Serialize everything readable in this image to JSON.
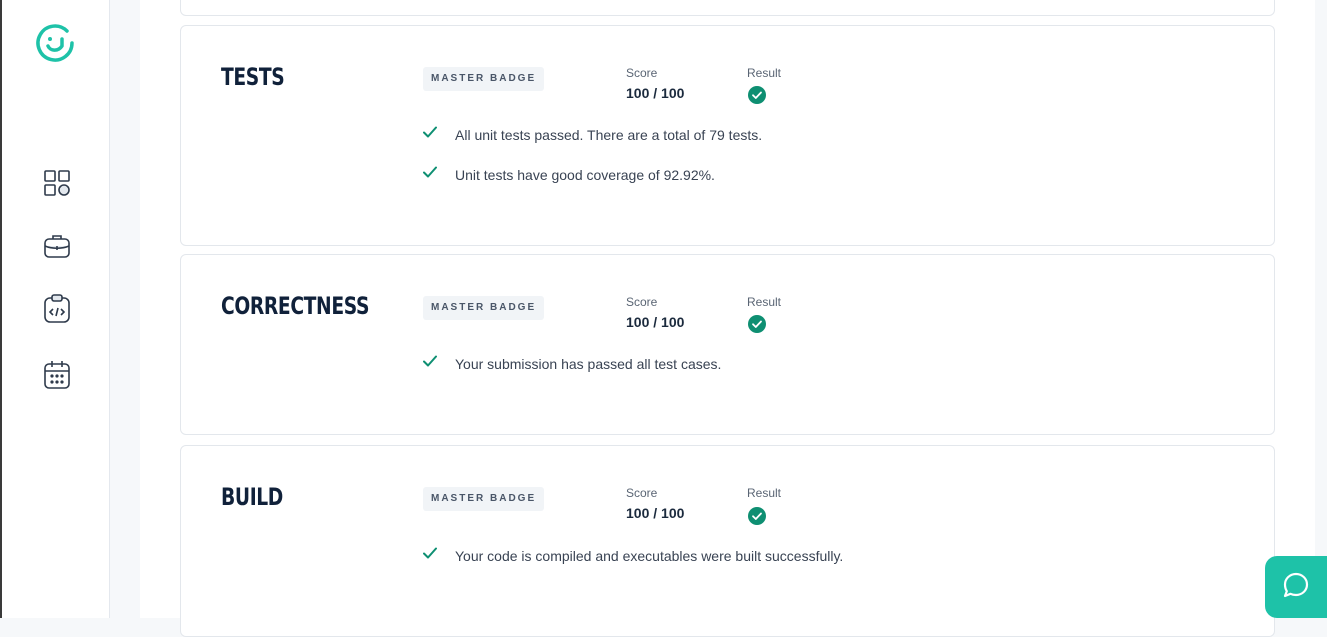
{
  "colors": {
    "accent": "#1ec2a8",
    "check": "#0e8f72",
    "heading": "#10213a"
  },
  "sidebar": {
    "items": [
      {
        "icon": "dashboard-icon"
      },
      {
        "icon": "briefcase-icon"
      },
      {
        "icon": "code-clipboard-icon"
      },
      {
        "icon": "calendar-icon"
      }
    ]
  },
  "sections": [
    {
      "title": "TESTS",
      "badge": "MASTER BADGE",
      "score_label": "Score",
      "score_value": "100 / 100",
      "result_label": "Result",
      "result_icon": "check-circle-icon",
      "messages": [
        "All unit tests passed. There are a total of 79 tests.",
        "Unit tests have good coverage of 92.92%."
      ]
    },
    {
      "title": "CORRECTNESS",
      "badge": "MASTER BADGE",
      "score_label": "Score",
      "score_value": "100 / 100",
      "result_label": "Result",
      "result_icon": "check-circle-icon",
      "messages": [
        "Your submission has passed all test cases."
      ]
    },
    {
      "title": "BUILD",
      "badge": "MASTER BADGE",
      "score_label": "Score",
      "score_value": "100 / 100",
      "result_label": "Result",
      "result_icon": "check-circle-icon",
      "messages": [
        "Your code is compiled and executables were built successfully."
      ]
    }
  ],
  "chat": {
    "icon": "chat-bubble-icon"
  }
}
